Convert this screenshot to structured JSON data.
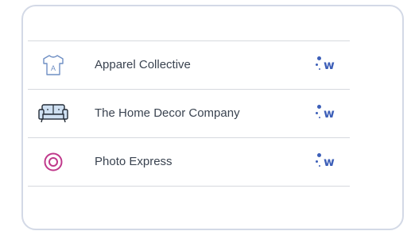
{
  "colors": {
    "card_border": "#d3d9e6",
    "divider": "#d6d9de",
    "label_text": "#3a4350",
    "brand_blue": "#3d5fb8",
    "tshirt_icon": "#6f8fc4",
    "sofa_fill": "#cfe0f2",
    "target_icon": "#c0398b"
  },
  "rows": [
    {
      "icon": "tshirt-icon",
      "icon_letter": "A",
      "label": "Apparel Collective",
      "brand_letter": "w"
    },
    {
      "icon": "sofa-icon",
      "label": "The Home Decor Company",
      "brand_letter": "w"
    },
    {
      "icon": "target-circle-icon",
      "label": "Photo Express",
      "brand_letter": "w"
    }
  ]
}
